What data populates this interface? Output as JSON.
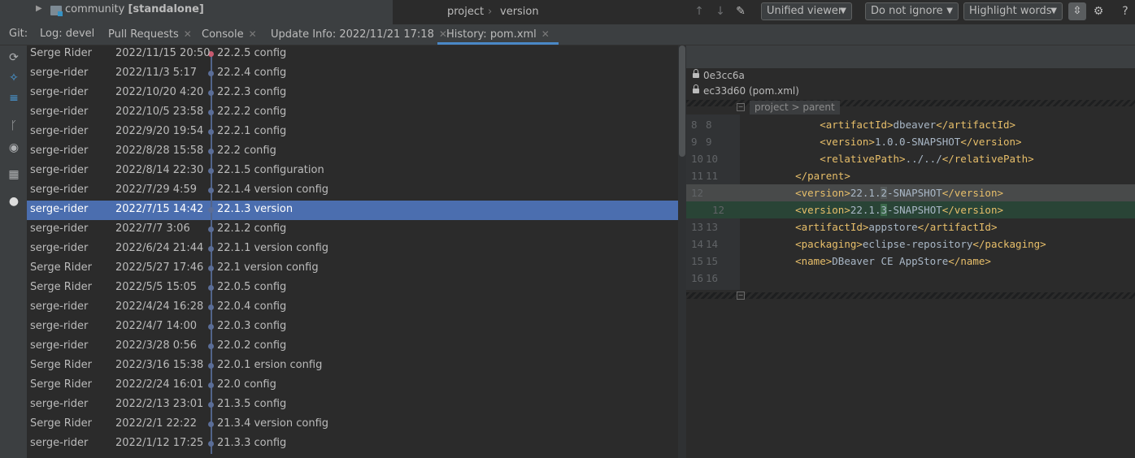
{
  "project_tree": {
    "item": "community",
    "item_bold": "[standalone]"
  },
  "breadcrumbs": [
    "project",
    "version"
  ],
  "tabs": {
    "git_label": "Git:",
    "items": [
      {
        "label": "Log: devel"
      },
      {
        "label": "Pull Requests"
      },
      {
        "label": "Console"
      },
      {
        "label": "Update Info: 2022/11/21 17:18"
      },
      {
        "label": "History: pom.xml"
      }
    ]
  },
  "sidebar_icons": [
    "refresh-icon",
    "cherry-pick-icon",
    "compare-icon",
    "branch-icon",
    "eye-icon",
    "layout-icon",
    "github-icon"
  ],
  "commits": [
    {
      "author": "Serge Rider",
      "date": "2022/11/15 20:50",
      "message": "22.2.5 config"
    },
    {
      "author": "serge-rider",
      "date": "2022/11/3 5:17",
      "message": "22.2.4 config"
    },
    {
      "author": "serge-rider",
      "date": "2022/10/20 4:20",
      "message": "22.2.3 config"
    },
    {
      "author": "serge-rider",
      "date": "2022/10/5 23:58",
      "message": "22.2.2 config"
    },
    {
      "author": "serge-rider",
      "date": "2022/9/20 19:54",
      "message": "22.2.1 config"
    },
    {
      "author": "serge-rider",
      "date": "2022/8/28 15:58",
      "message": "22.2 config"
    },
    {
      "author": "serge-rider",
      "date": "2022/8/14 22:30",
      "message": "22.1.5 configuration"
    },
    {
      "author": "serge-rider",
      "date": "2022/7/29 4:59",
      "message": "22.1.4 version config"
    },
    {
      "author": "serge-rider",
      "date": "2022/7/15 14:42",
      "message": "22.1.3 version"
    },
    {
      "author": "serge-rider",
      "date": "2022/7/7 3:06",
      "message": "22.1.2 config"
    },
    {
      "author": "serge-rider",
      "date": "2022/6/24 21:44",
      "message": "22.1.1 version config"
    },
    {
      "author": "Serge Rider",
      "date": "2022/5/27 17:46",
      "message": "22.1 version config"
    },
    {
      "author": "Serge Rider",
      "date": "2022/5/5 15:05",
      "message": "22.0.5 config"
    },
    {
      "author": "serge-rider",
      "date": "2022/4/24 16:28",
      "message": "22.0.4 config"
    },
    {
      "author": "serge-rider",
      "date": "2022/4/7 14:00",
      "message": "22.0.3 config"
    },
    {
      "author": "serge-rider",
      "date": "2022/3/28 0:56",
      "message": "22.0.2 config"
    },
    {
      "author": "Serge Rider",
      "date": "2022/3/16 15:38",
      "message": "22.0.1 ersion config"
    },
    {
      "author": "Serge Rider",
      "date": "2022/2/24 16:01",
      "message": "22.0 config"
    },
    {
      "author": "serge-rider",
      "date": "2022/2/13 23:01",
      "message": "21.3.5 config"
    },
    {
      "author": "Serge Rider",
      "date": "2022/2/1 22:22",
      "message": "21.3.4 version config"
    },
    {
      "author": "serge-rider",
      "date": "2022/1/12 17:25",
      "message": "21.3.3 config"
    }
  ],
  "selected_index": 8,
  "diff": {
    "viewer_mode": "Unified viewer",
    "whitespace_mode": "Do not ignore",
    "highlight_mode": "Highlight words",
    "revision_left": "0e3cc6a",
    "revision_right": "ec33d60 (pom.xml)",
    "breadcrumb": "project > parent",
    "lines": [
      {
        "left": "8",
        "right": "8",
        "kind": "ctx",
        "indent": "        ",
        "open": "<artifactId>",
        "text": "dbeaver",
        "close": "</artifactId>"
      },
      {
        "left": "9",
        "right": "9",
        "kind": "ctx",
        "indent": "        ",
        "open": "<version>",
        "text": "1.0.0-SNAPSHOT",
        "close": "</version>"
      },
      {
        "left": "10",
        "right": "10",
        "kind": "ctx",
        "indent": "        ",
        "open": "<relativePath>",
        "text": "../../",
        "close": "</relativePath>"
      },
      {
        "left": "11",
        "right": "11",
        "kind": "ctx",
        "indent": "    ",
        "open": "</parent>",
        "text": "",
        "close": ""
      },
      {
        "left": "12",
        "right": "",
        "kind": "del",
        "indent": "    ",
        "open": "<version>",
        "text_pre": "22.1.",
        "text_chg": "2",
        "text_post": "-SNAPSHOT",
        "close": "</version>"
      },
      {
        "left": "",
        "right": "12",
        "kind": "add",
        "indent": "    ",
        "open": "<version>",
        "text_pre": "22.1.",
        "text_chg": "3",
        "text_post": "-SNAPSHOT",
        "close": "</version>"
      },
      {
        "left": "13",
        "right": "13",
        "kind": "ctx",
        "indent": "    ",
        "open": "<artifactId>",
        "text": "appstore",
        "close": "</artifactId>"
      },
      {
        "left": "14",
        "right": "14",
        "kind": "ctx",
        "indent": "    ",
        "open": "<packaging>",
        "text": "eclipse-repository",
        "close": "</packaging>"
      },
      {
        "left": "15",
        "right": "15",
        "kind": "ctx",
        "indent": "    ",
        "open": "<name>",
        "text": "DBeaver CE AppStore",
        "close": "</name>"
      },
      {
        "left": "16",
        "right": "16",
        "kind": "ctx",
        "indent": "",
        "open": "",
        "text": "",
        "close": ""
      }
    ]
  },
  "colors": {
    "selection": "#4b6eaf",
    "graph_head": "#c75a6f",
    "graph_line": "#52648a",
    "tag": "#e8bf6a"
  }
}
